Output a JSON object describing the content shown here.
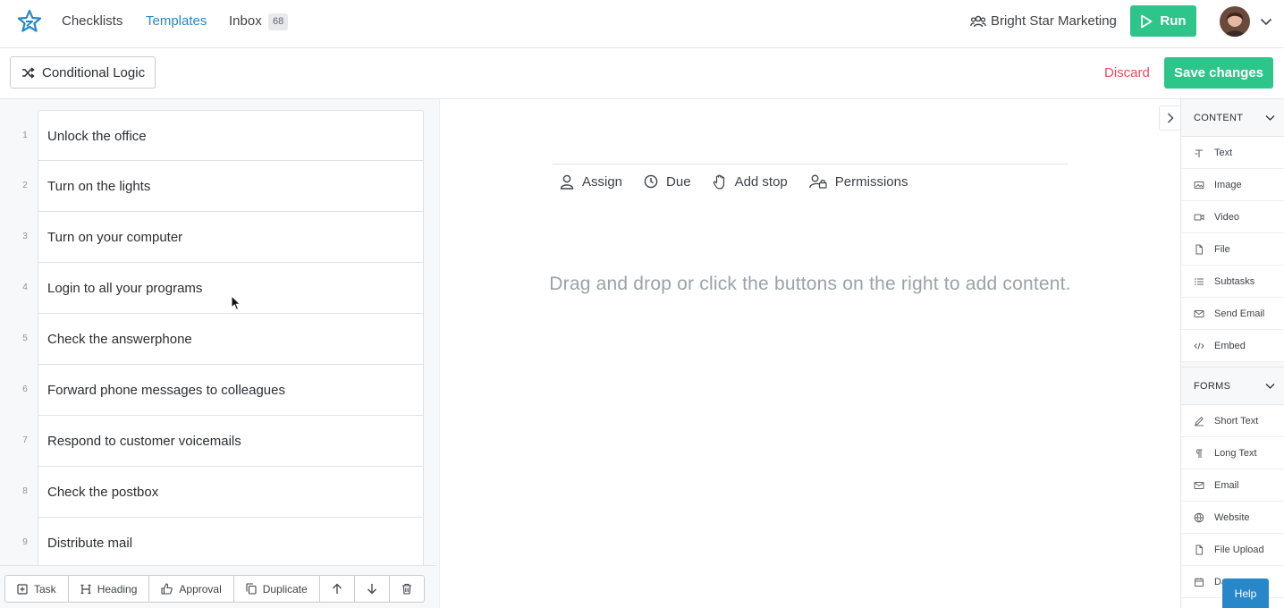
{
  "nav": {
    "links": [
      "Checklists",
      "Templates",
      "Inbox"
    ],
    "active": "Templates",
    "inbox_count": "68",
    "org_name": "Bright Star Marketing",
    "run_label": "Run"
  },
  "toolbar": {
    "conditional_logic_label": "Conditional Logic",
    "discard_label": "Discard",
    "save_label": "Save changes"
  },
  "tasks": [
    {
      "num": "1",
      "label": "Unlock the office"
    },
    {
      "num": "2",
      "label": "Turn on the lights"
    },
    {
      "num": "3",
      "label": "Turn on your computer"
    },
    {
      "num": "4",
      "label": "Login to all your programs"
    },
    {
      "num": "5",
      "label": "Check the answerphone"
    },
    {
      "num": "6",
      "label": "Forward phone messages to colleagues"
    },
    {
      "num": "7",
      "label": "Respond to customer voicemails"
    },
    {
      "num": "8",
      "label": "Check the postbox"
    },
    {
      "num": "9",
      "label": "Distribute mail"
    }
  ],
  "actions": {
    "task": "Task",
    "heading": "Heading",
    "approval": "Approval",
    "duplicate": "Duplicate"
  },
  "editor": {
    "assign": "Assign",
    "due": "Due",
    "add_stop": "Add stop",
    "permissions": "Permissions",
    "placeholder": "Drag and drop or click the buttons on the right to add content."
  },
  "sidebar": {
    "content_title": "CONTENT",
    "content_items": [
      "Text",
      "Image",
      "Video",
      "File",
      "Subtasks",
      "Send Email",
      "Embed"
    ],
    "forms_title": "FORMS",
    "forms_items": [
      "Short Text",
      "Long Text",
      "Email",
      "Website",
      "File Upload",
      "Date"
    ],
    "help_label": "Help"
  },
  "colors": {
    "accent_blue": "#2787c8",
    "brand_green": "#2ec58b",
    "danger_red": "#e04e5c"
  }
}
